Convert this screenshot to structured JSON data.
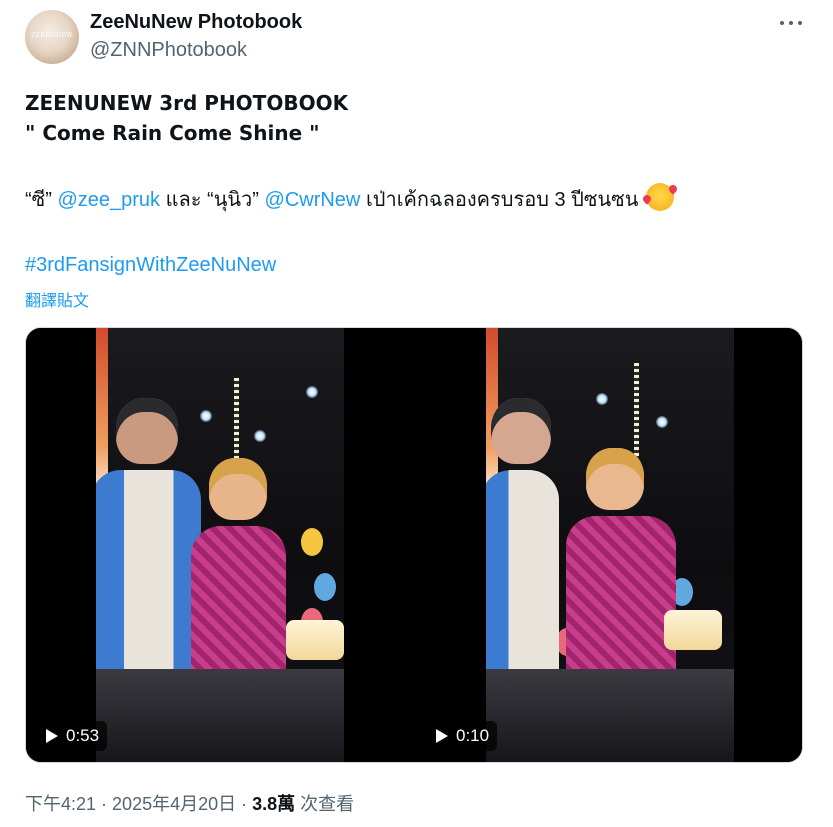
{
  "author": {
    "name": "ZeeNuNew Photobook",
    "handle": "@ZNNPhotobook",
    "avatar_text": "ZEENUNEW"
  },
  "post": {
    "title_line1": "ZEENUNEW 3rd PHOTOBOOK",
    "title_line2": "\" Come Rain Come Shine \"",
    "text_open1": "“ซี”",
    "mention1": "@zee_pruk",
    "text_and": "และ “นุนิว”",
    "mention2": "@CwrNew",
    "text_rest": "เป่าเค้กฉลองครบรอบ 3 ปีซนซน",
    "emoji_icon": "smiling-face-with-hearts-icon",
    "hashtag": "#3rdFansignWithZeeNuNew",
    "translate_label": "翻譯貼文"
  },
  "media": {
    "videos": [
      {
        "duration": "0:53"
      },
      {
        "duration": "0:10"
      }
    ]
  },
  "meta": {
    "time": "下午4:21",
    "sep1": " · ",
    "date": "2025年4月20日",
    "sep2": " · ",
    "views_count": "3.8萬",
    "views_label": "次查看"
  },
  "colors": {
    "link": "#1d9bf0",
    "secondary_text": "#536471",
    "primary_text": "#0f1419"
  }
}
